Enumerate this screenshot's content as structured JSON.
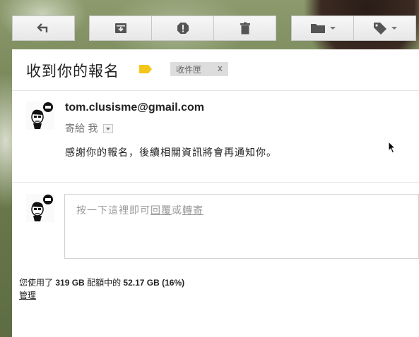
{
  "toolbar": {
    "buttons": [
      {
        "name": "back-button",
        "icon": "back-arrow-icon"
      },
      {
        "name": "archive-button",
        "icon": "archive-icon"
      },
      {
        "name": "report-spam-button",
        "icon": "alert-icon"
      },
      {
        "name": "delete-button",
        "icon": "trash-icon"
      },
      {
        "name": "move-to-button",
        "icon": "folder-icon"
      },
      {
        "name": "labels-button",
        "icon": "label-icon"
      }
    ]
  },
  "message": {
    "subject": "收到你的報名",
    "label_color": "#f5c518",
    "inbox_chip": {
      "label": "收件匣",
      "remove": "x"
    },
    "sender": "tom.clusisme@gmail.com",
    "to_label": "寄給 我",
    "body": "感謝你的報名，後續相關資訊將會再通知你。"
  },
  "reply": {
    "prefix": "按一下這裡即可",
    "reply_link": "回覆",
    "or": "或",
    "forward_link": "轉寄"
  },
  "quota": {
    "lead": "您使用了",
    "used": "319 GB",
    "mid": "配額中的",
    "total": "52.17 GB (16%)",
    "manage": "管理"
  }
}
